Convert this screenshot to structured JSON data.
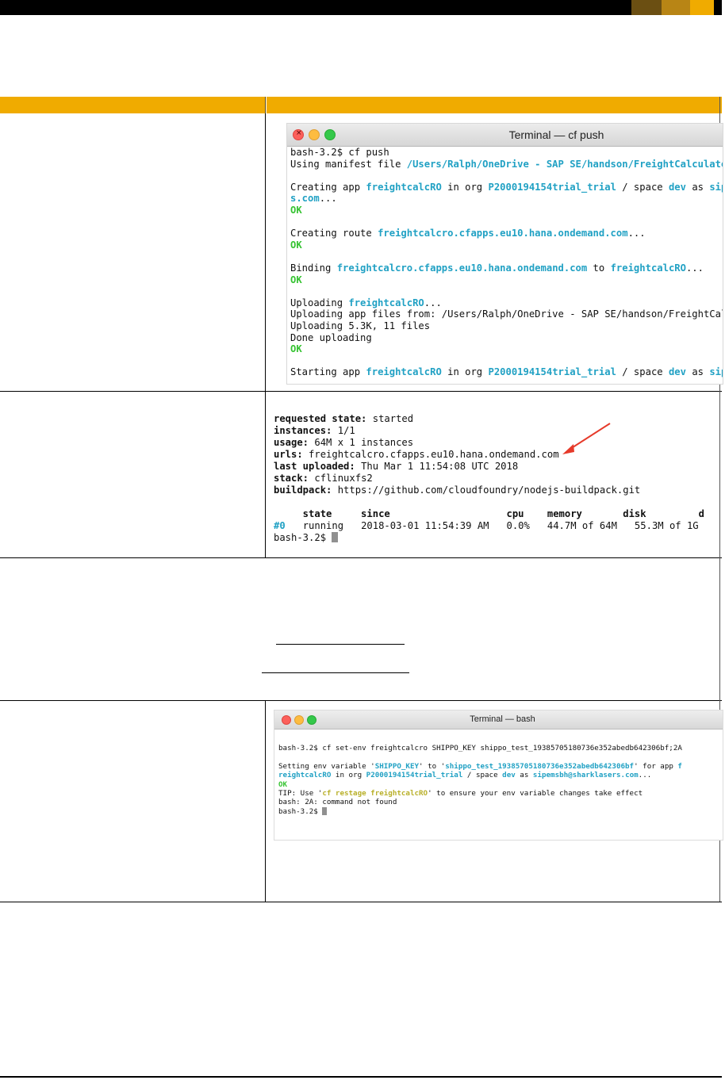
{
  "colors": {
    "header_bar": "#f0ab00",
    "terminal_highlight": "#21a1c4",
    "terminal_ok": "#36c332",
    "terminal_tip": "#b9b02a",
    "annotation_arrow": "#e63a2a"
  },
  "terminal_push": {
    "title": "Terminal — cf push",
    "l1": "bash-3.2$ cf push",
    "l2a": "Using manifest file ",
    "l2b": "/Users/Ralph/OneDrive - SAP SE/handson/FreightCalculato",
    "l3a": "Creating app ",
    "l3b": "freightcalcRO",
    "l3c": " in org ",
    "l3d": "P2000194154trial_trial",
    "l3e": " / space ",
    "l3f": "dev",
    "l3g": " as ",
    "l3h": "sip",
    "l4a": "s.com",
    "l4b": "...",
    "ok": "OK",
    "l6a": "Creating route ",
    "l6b": "freightcalcro.cfapps.eu10.hana.ondemand.com",
    "l6c": "...",
    "l8a": "Binding ",
    "l8b": "freightcalcro.cfapps.eu10.hana.ondemand.com",
    "l8c": " to ",
    "l8d": "freightcalcRO",
    "l8e": "...",
    "l10a": "Uploading ",
    "l10b": "freightcalcRO",
    "l10c": "...",
    "l11": "Uploading app files from: /Users/Ralph/OneDrive - SAP SE/handson/FreightCal",
    "l12": "Uploading 5.3K, 11 files",
    "l13": "Done uploading",
    "l15a": "Starting app ",
    "l15b": "freightcalcRO",
    "l15c": " in org ",
    "l15d": "P2000194154trial_trial",
    "l15e": " / space ",
    "l15f": "dev",
    "l15g": " as ",
    "l15h": "sip"
  },
  "app_status": {
    "requested_state_label": "requested state:",
    "requested_state_value": " started",
    "instances_label": "instances:",
    "instances_value": " 1/1",
    "usage_label": "usage:",
    "usage_value": " 64M x 1 instances",
    "urls_label": "urls:",
    "urls_value": " freightcalcro.cfapps.eu10.hana.ondemand.com",
    "last_uploaded_label": "last uploaded:",
    "last_uploaded_value": " Thu Mar 1 11:54:08 UTC 2018",
    "stack_label": "stack:",
    "stack_value": " cflinuxfs2",
    "buildpack_label": "buildpack:",
    "buildpack_value": " https://github.com/cloudfoundry/nodejs-buildpack.git",
    "table_header": "     state     since                    cpu    memory       disk         d",
    "row_id": "#0",
    "row_rest": "   running   2018-03-01 11:54:39 AM   0.0%   44.7M of 64M   55.3M of 1G",
    "prompt": "bash-3.2$ "
  },
  "terminal_bash": {
    "title": "Terminal — bash",
    "l1": "bash-3.2$ cf set-env freightcalcro SHIPPO_KEY shippo_test_19385705180736e352abedb642306bf;2A",
    "l2a": "Setting env variable '",
    "l2b": "SHIPPO_KEY",
    "l2c": "' to '",
    "l2d": "shippo_test_19385705180736e352abedb642306bf",
    "l2e": "' for app ",
    "l2f": "f",
    "l3a": "reightcalcRO",
    "l3b": " in org ",
    "l3c": "P2000194154trial_trial",
    "l3d": " / space ",
    "l3e": "dev",
    "l3f": " as ",
    "l3g": "sipemsbh@sharklasers.com",
    "l3h": "...",
    "ok": "OK",
    "l5a": "TIP: Use '",
    "l5b": "cf restage freightcalcRO",
    "l5c": "' to ensure your env variable changes take effect",
    "l6": "bash: 2A: command not found",
    "l7": "bash-3.2$ "
  }
}
